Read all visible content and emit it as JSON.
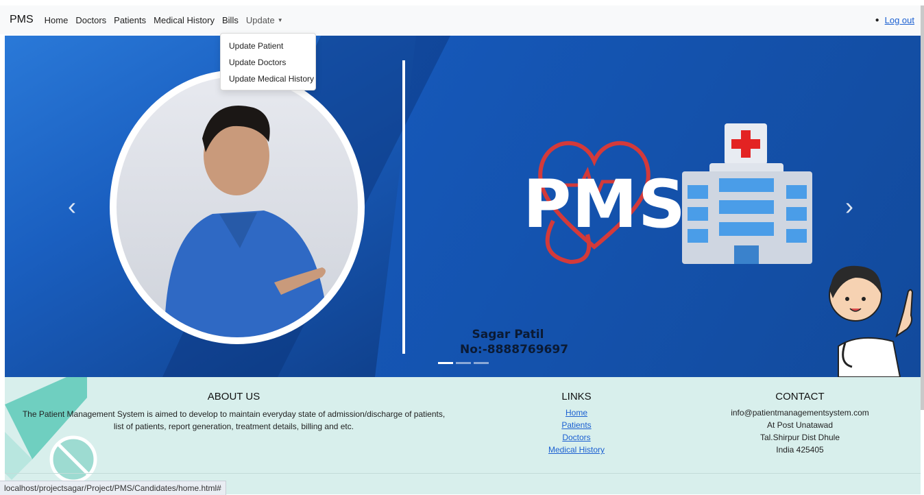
{
  "navbar": {
    "brand": "PMS",
    "items": [
      "Home",
      "Doctors",
      "Patients",
      "Medical History",
      "Bills"
    ],
    "update_label": "Update",
    "logout_label": "Log out"
  },
  "dropdown": {
    "items": [
      "Update Patient",
      "Update Doctors",
      "Update Medical History"
    ]
  },
  "carousel": {
    "logo_text": "PMS",
    "caption_name": "Sagar Patil",
    "caption_number": "No:-8888769697",
    "slide_count": 3,
    "active_slide": 1
  },
  "footer": {
    "about_title": "ABOUT US",
    "about_text": "The Patient Management System is aimed to develop to maintain everyday state of admission/discharge of patients, list of patients, report generation, treatment details, billing and etc.",
    "links_title": "LINKS",
    "links": [
      "Home",
      "Patients",
      "Doctors",
      "Medical History"
    ],
    "contact_title": "CONTACT",
    "contact_lines": [
      "info@patientmanagementsystem.com",
      "At Post Unatawad",
      "Tal.Shirpur Dist Dhule",
      "India 425405"
    ]
  },
  "status_url": "localhost/projectsagar/Project/PMS/Candidates/home.html#",
  "colors": {
    "link": "#1a5fd1",
    "footer_bg": "#d8efec",
    "carousel_blue": "#1556b5"
  }
}
